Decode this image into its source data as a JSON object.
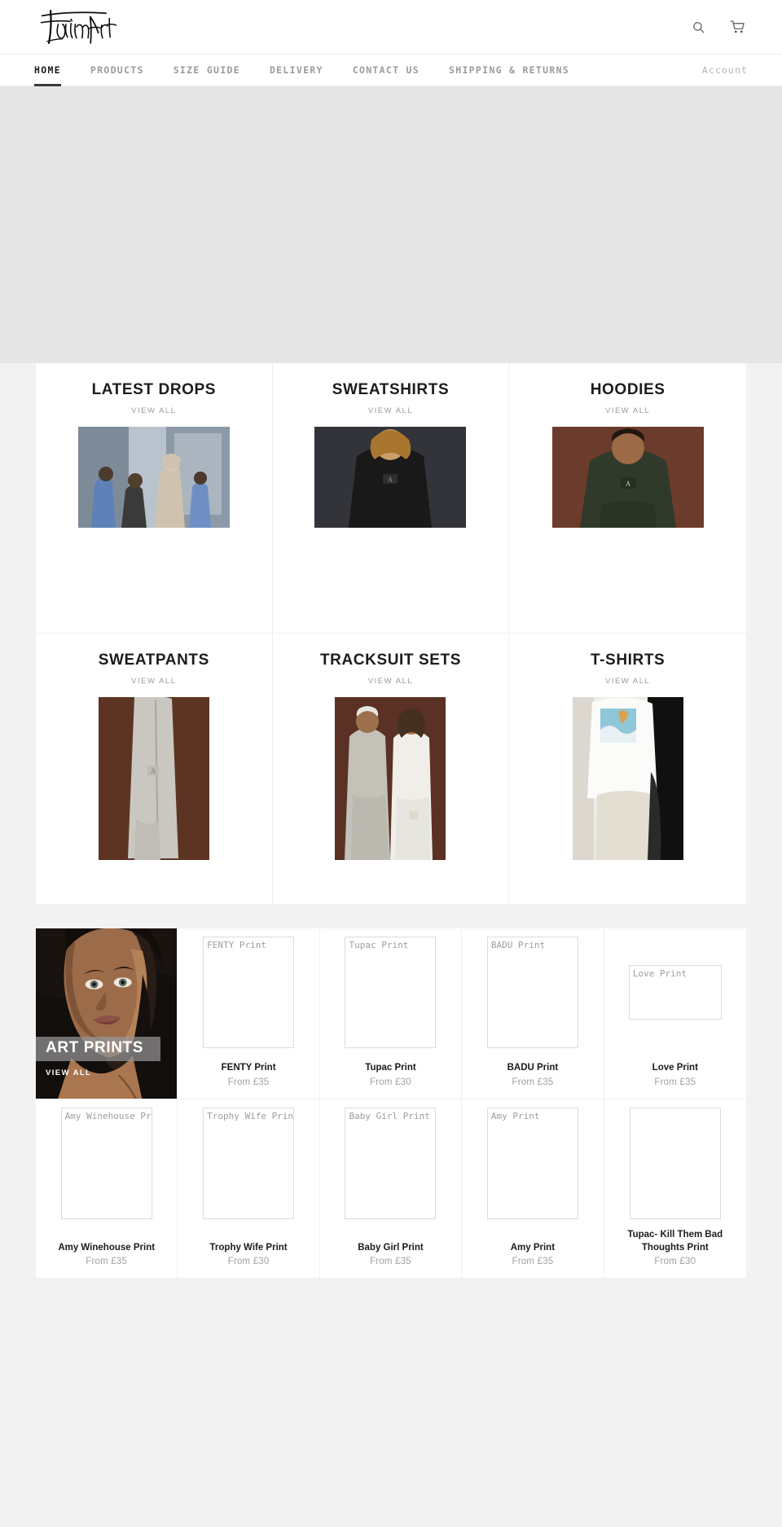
{
  "header": {
    "logo_text": "FatimArt",
    "search_icon": "search-icon",
    "cart_icon": "shopping-cart-icon"
  },
  "nav": {
    "items": [
      {
        "label": "HOME",
        "active": true
      },
      {
        "label": "PRODUCTS",
        "active": false
      },
      {
        "label": "SIZE GUIDE",
        "active": false
      },
      {
        "label": "DELIVERY",
        "active": false
      },
      {
        "label": "CONTACT US",
        "active": false
      },
      {
        "label": "SHIPPING & RETURNS",
        "active": false
      }
    ],
    "account_label": "Account"
  },
  "collections": {
    "view_all_label": "VIEW ALL",
    "items": [
      {
        "title": "LATEST DROPS",
        "view_all": "VIEW ALL",
        "shape": "wide",
        "image": "group-streetwear-photo"
      },
      {
        "title": "SWEATSHIRTS",
        "view_all": "VIEW ALL",
        "shape": "wide",
        "image": "black-sweatshirt-photo"
      },
      {
        "title": "HOODIES",
        "view_all": "VIEW ALL",
        "shape": "wide",
        "image": "green-hoodie-photo"
      },
      {
        "title": "SWEATPANTS",
        "view_all": "VIEW ALL",
        "shape": "tall",
        "image": "grey-sweatpants-photo"
      },
      {
        "title": "TRACKSUIT SETS",
        "view_all": "VIEW ALL",
        "shape": "tall",
        "image": "tracksuit-couple-photo"
      },
      {
        "title": "T-SHIRTS",
        "view_all": "VIEW ALL",
        "shape": "tall",
        "image": "white-tshirt-photo"
      }
    ]
  },
  "art_prints": {
    "feature": {
      "title": "ART PRINTS",
      "view_all": "VIEW ALL",
      "image": "rihanna-portrait-painting"
    },
    "products": [
      {
        "alt": "FENTY Print",
        "name": "FENTY Print",
        "price": "From £35",
        "box": "tall"
      },
      {
        "alt": "Tupac Print",
        "name": "Tupac Print",
        "price": "From £30",
        "box": "tall"
      },
      {
        "alt": "BADU Print",
        "name": "BADU Print",
        "price": "From £35",
        "box": "tall"
      },
      {
        "alt": "Love Print",
        "name": "Love Print",
        "price": "From £35",
        "box": "wide"
      },
      {
        "alt": "Amy Winehouse Print",
        "name": "Amy Winehouse Print",
        "price": "From £35",
        "box": "tall"
      },
      {
        "alt": "Trophy Wife Print",
        "name": "Trophy Wife Print",
        "price": "From £30",
        "box": "tall"
      },
      {
        "alt": "Baby Girl Print",
        "name": "Baby Girl Print",
        "price": "From £35",
        "box": "tall"
      },
      {
        "alt": "Amy Print",
        "name": "Amy Print",
        "price": "From £35",
        "box": "tall"
      },
      {
        "alt": "",
        "name": "Tupac- Kill Them Bad Thoughts Print",
        "price": "From £30",
        "box": "tall"
      }
    ]
  },
  "colors": {
    "hero_bg": "#e6e6e6",
    "page_bg": "#f2f2f2",
    "card_bg": "#ffffff",
    "text_dark": "#1c1c1c",
    "text_muted": "#9a9a9a"
  }
}
